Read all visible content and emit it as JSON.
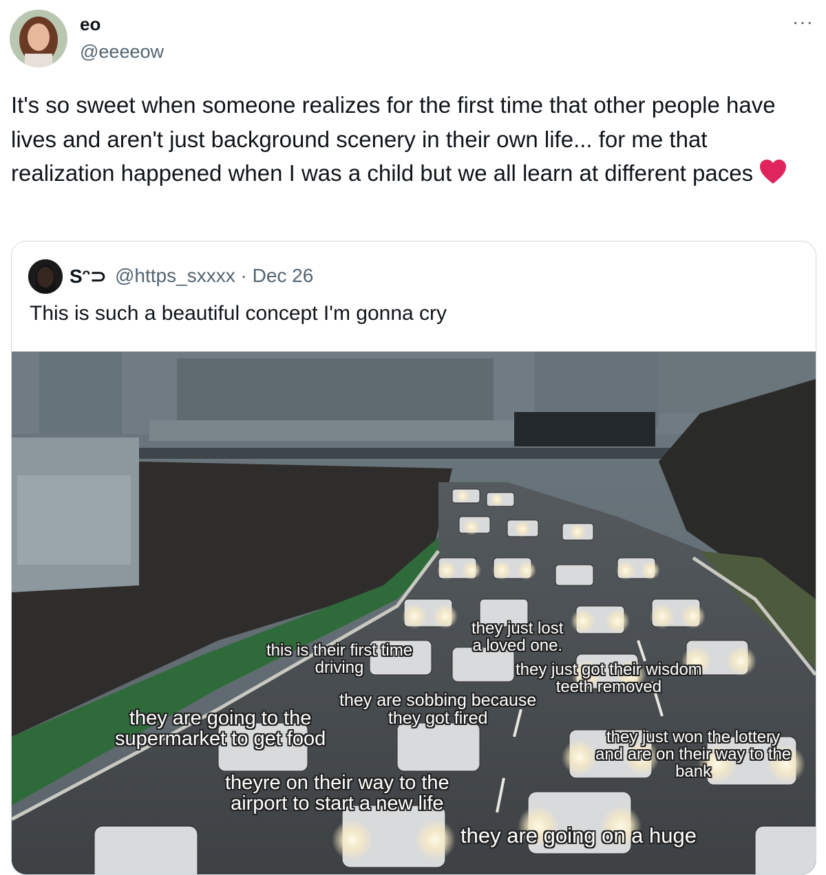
{
  "tweet": {
    "author_name": "eo",
    "author_handle": "@eeeeow",
    "more_label": "···",
    "text": "It's so sweet when someone realizes for the first time that other people have lives and aren't just background scenery in their own life... for me that realization happened when I was a child but we all learn at different paces",
    "emoji_icon": "red-heart-icon"
  },
  "quote": {
    "author_name": "Sᵔ⊃",
    "author_handle": "@https_sxxxx",
    "separator": "·",
    "date": "Dec 26",
    "text": "This is such a beautiful concept I'm gonna cry"
  },
  "media_captions": [
    {
      "text": "this is their first time\ndriving"
    },
    {
      "text": "they just lost\na loved one."
    },
    {
      "text": "they just got their wisdom\nteeth removed"
    },
    {
      "text": "they are sobbing because\nthey got fired"
    },
    {
      "text": "they are going to the\nsupermarket to get food"
    },
    {
      "text": "they just won the lottery\nand are on their way to the\nbank"
    },
    {
      "text": "theyre on their way to the\nairport to start a new life"
    },
    {
      "text": "they are going on a huge"
    }
  ],
  "colors": {
    "text_primary": "#0f1419",
    "text_secondary": "#536471",
    "border": "#cfd9de",
    "heart": "#e0245e"
  }
}
